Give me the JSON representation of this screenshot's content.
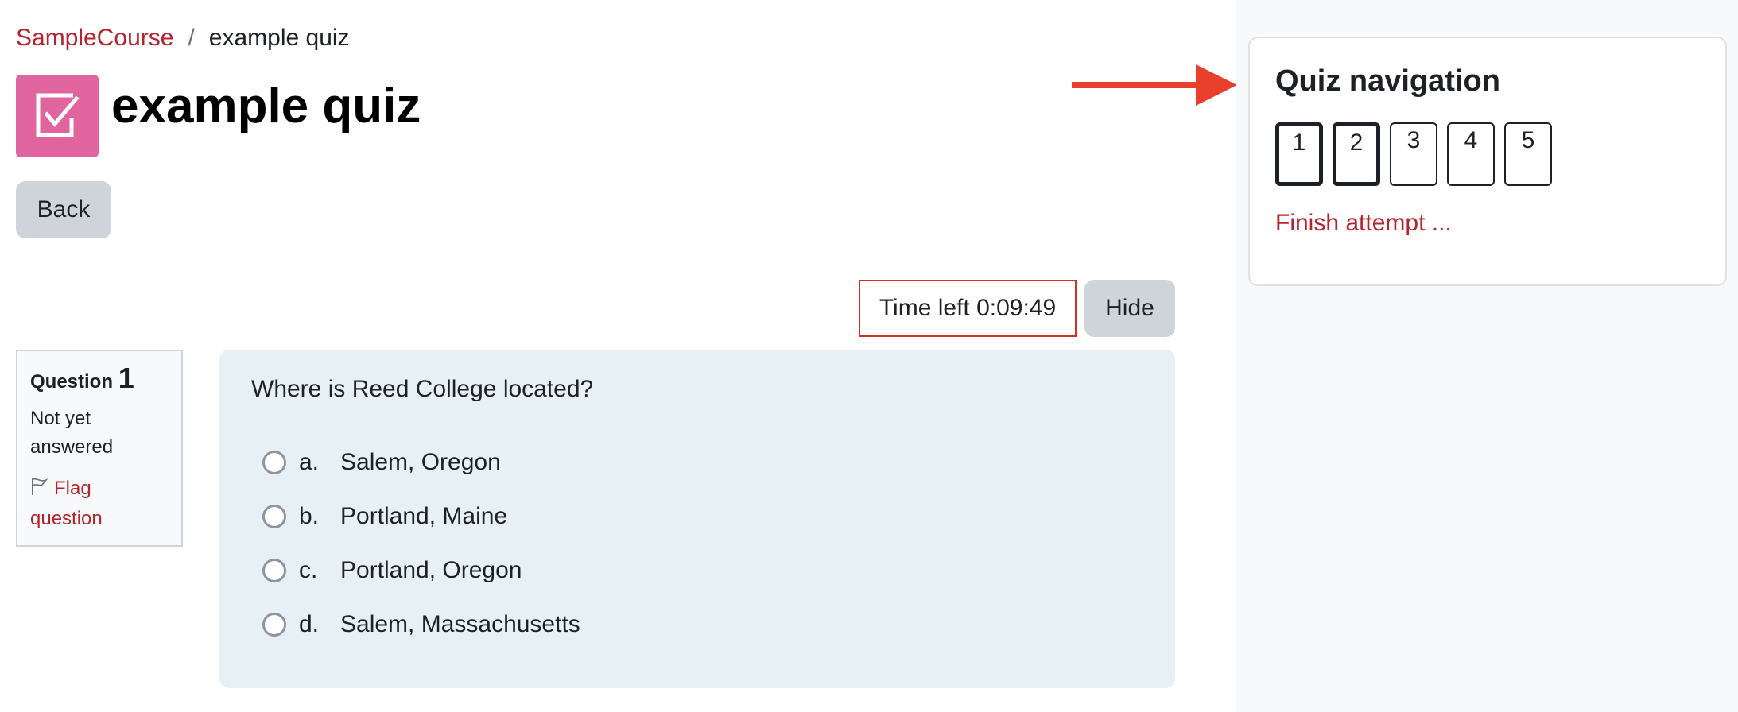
{
  "breadcrumb": {
    "course": "SampleCourse",
    "separator": "/",
    "current": "example quiz"
  },
  "page": {
    "title": "example quiz",
    "icon": "checkbox-icon",
    "back_label": "Back"
  },
  "timer": {
    "text": "Time left 0:09:49",
    "hide_label": "Hide"
  },
  "question_info": {
    "heading": "Question",
    "number": "1",
    "state": "Not yet answered",
    "flag_label": "Flag question"
  },
  "question": {
    "text": "Where is Reed College located?",
    "answers": [
      {
        "letter": "a.",
        "label": "Salem, Oregon"
      },
      {
        "letter": "b.",
        "label": "Portland, Maine"
      },
      {
        "letter": "c.",
        "label": "Portland, Oregon"
      },
      {
        "letter": "d.",
        "label": "Salem, Massachusetts"
      }
    ]
  },
  "quiz_navigation": {
    "title": "Quiz navigation",
    "buttons": [
      "1",
      "2",
      "3",
      "4",
      "5"
    ],
    "finish_label": "Finish attempt ..."
  },
  "colors": {
    "link": "#b5242c",
    "quiz_icon_bg": "#e0659e",
    "arrow": "#e8402a",
    "question_bg": "#e7f1f5"
  }
}
